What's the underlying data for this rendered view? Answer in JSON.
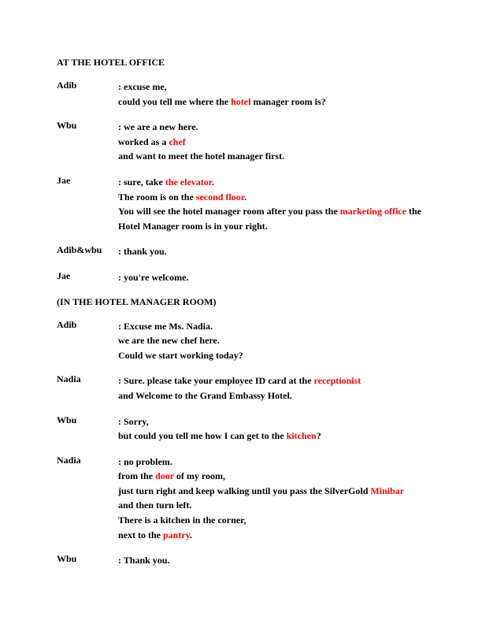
{
  "heading1": "AT THE HOTEL OFFICE",
  "heading2": "(IN THE HOTEL MANAGER ROOM)",
  "block1": [
    {
      "speaker": "Adib",
      "lines": [
        [
          {
            "t": ":  excuse me,"
          }
        ],
        [
          {
            "t": "could you tell me where the "
          },
          {
            "t": "hotel",
            "red": true
          },
          {
            "t": " manager room is?"
          }
        ]
      ]
    },
    {
      "speaker": "Wbu",
      "lines": [
        [
          {
            "t": ": we are a new here."
          }
        ],
        [
          {
            "t": "worked as a "
          },
          {
            "t": "chef",
            "red": true
          }
        ],
        [
          {
            "t": "and want to meet the hotel manager first."
          }
        ]
      ]
    },
    {
      "speaker": "Jae",
      "lines": [
        [
          {
            "t": ": sure,  take "
          },
          {
            "t": "the elevator",
            "red": true
          },
          {
            "t": "."
          }
        ],
        [
          {
            "t": "The room is on the "
          },
          {
            "t": "second floor",
            "red": true
          },
          {
            "t": "."
          }
        ],
        [
          {
            "t": "You will see the hotel manager room after you pass the "
          },
          {
            "t": "marketing office",
            "red": true
          },
          {
            "t": " the"
          }
        ],
        [
          {
            "t": "Hotel Manager room is in your right."
          }
        ]
      ]
    },
    {
      "speaker": "Adib&wbu",
      "lines": [
        [
          {
            "t": ": thank you."
          }
        ]
      ]
    },
    {
      "speaker": "Jae",
      "lines": [
        [
          {
            "t": ": you're welcome."
          }
        ]
      ]
    }
  ],
  "block2": [
    {
      "speaker": "Adib",
      "lines": [
        [
          {
            "t": ": Excuse me Ms. Nadia."
          }
        ],
        [
          {
            "t": "we are the new chef here."
          }
        ],
        [
          {
            "t": "Could we start working today?"
          }
        ]
      ]
    },
    {
      "speaker": "Nadia",
      "lines": [
        [
          {
            "t": ": Sure. please take your employee ID card at the "
          },
          {
            "t": "receptionist",
            "red": true
          }
        ],
        [
          {
            "t": "and Welcome to the Grand Embassy Hotel."
          }
        ]
      ]
    },
    {
      "speaker": "Wbu",
      "lines": [
        [
          {
            "t": ": Sorry,"
          }
        ],
        [
          {
            "t": "but could you tell me how I can get to the "
          },
          {
            "t": "kitchen",
            "red": true
          },
          {
            "t": "?"
          }
        ]
      ]
    },
    {
      "speaker": "Nadia",
      "lines": [
        [
          {
            "t": ": no problem."
          }
        ],
        [
          {
            "t": "from the "
          },
          {
            "t": "door",
            "red": true
          },
          {
            "t": " of my room,"
          }
        ],
        [
          {
            "t": "just turn right and keep walking until you pass the SilverGold "
          },
          {
            "t": "Minibar",
            "red": true
          }
        ],
        [
          {
            "t": "and then turn left."
          }
        ],
        [
          {
            "t": "There is a kitchen in the corner,"
          }
        ],
        [
          {
            "t": "next to the "
          },
          {
            "t": "pantry",
            "red": true
          },
          {
            "t": "."
          }
        ]
      ]
    },
    {
      "speaker": "Wbu",
      "lines": [
        [
          {
            "t": ": Thank you."
          }
        ]
      ]
    }
  ]
}
